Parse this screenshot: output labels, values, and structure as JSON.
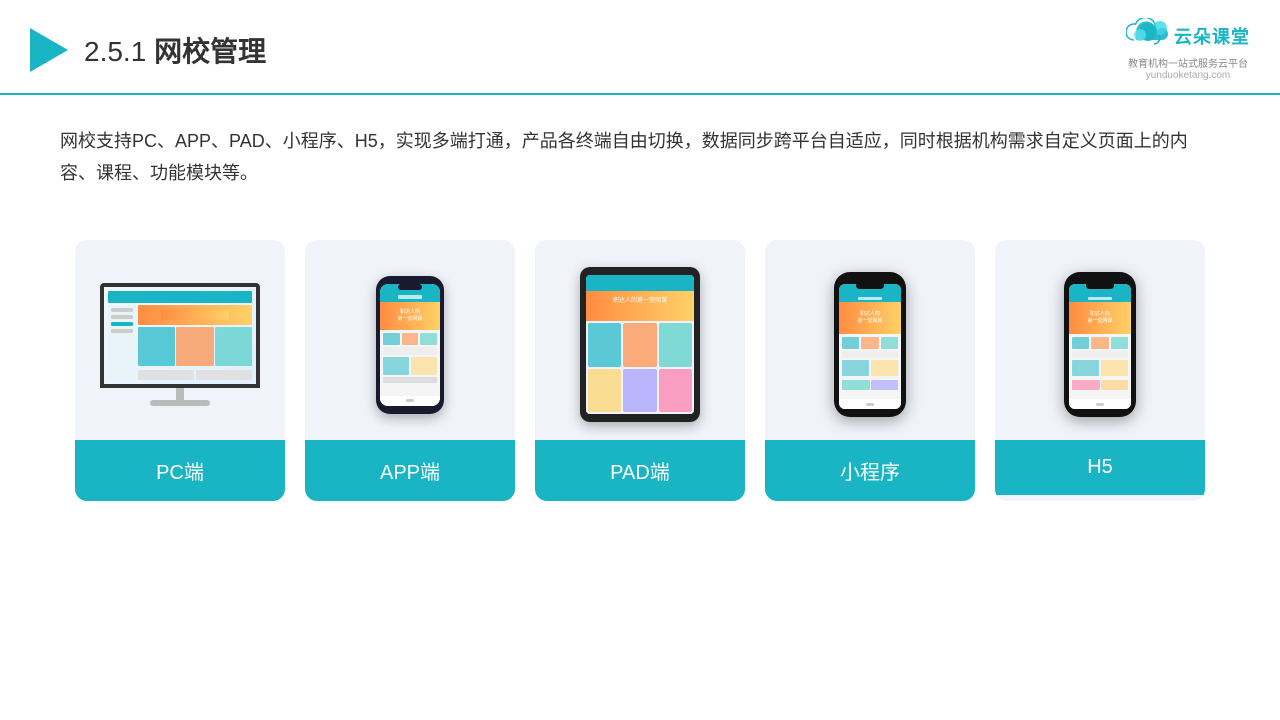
{
  "header": {
    "title_prefix": "2.5.1",
    "title_cn": "网校管理",
    "logo_text": "云朵课堂",
    "logo_tagline": "教育机构一站\n式服务云平台",
    "logo_domain": "yunduoketang.com"
  },
  "description": {
    "text": "网校支持PC、APP、PAD、小程序、H5，实现多端打通，产品各终端自由切换，数据同步跨平台自适应，同时根据机构需求自定义页面上的内容、课程、功能模块等。"
  },
  "cards": [
    {
      "id": "pc",
      "label": "PC端",
      "type": "monitor"
    },
    {
      "id": "app",
      "label": "APP端",
      "type": "phone"
    },
    {
      "id": "pad",
      "label": "PAD端",
      "type": "tablet"
    },
    {
      "id": "miniapp",
      "label": "小程序",
      "type": "phone-small"
    },
    {
      "id": "h5",
      "label": "H5",
      "type": "phone-small"
    }
  ]
}
